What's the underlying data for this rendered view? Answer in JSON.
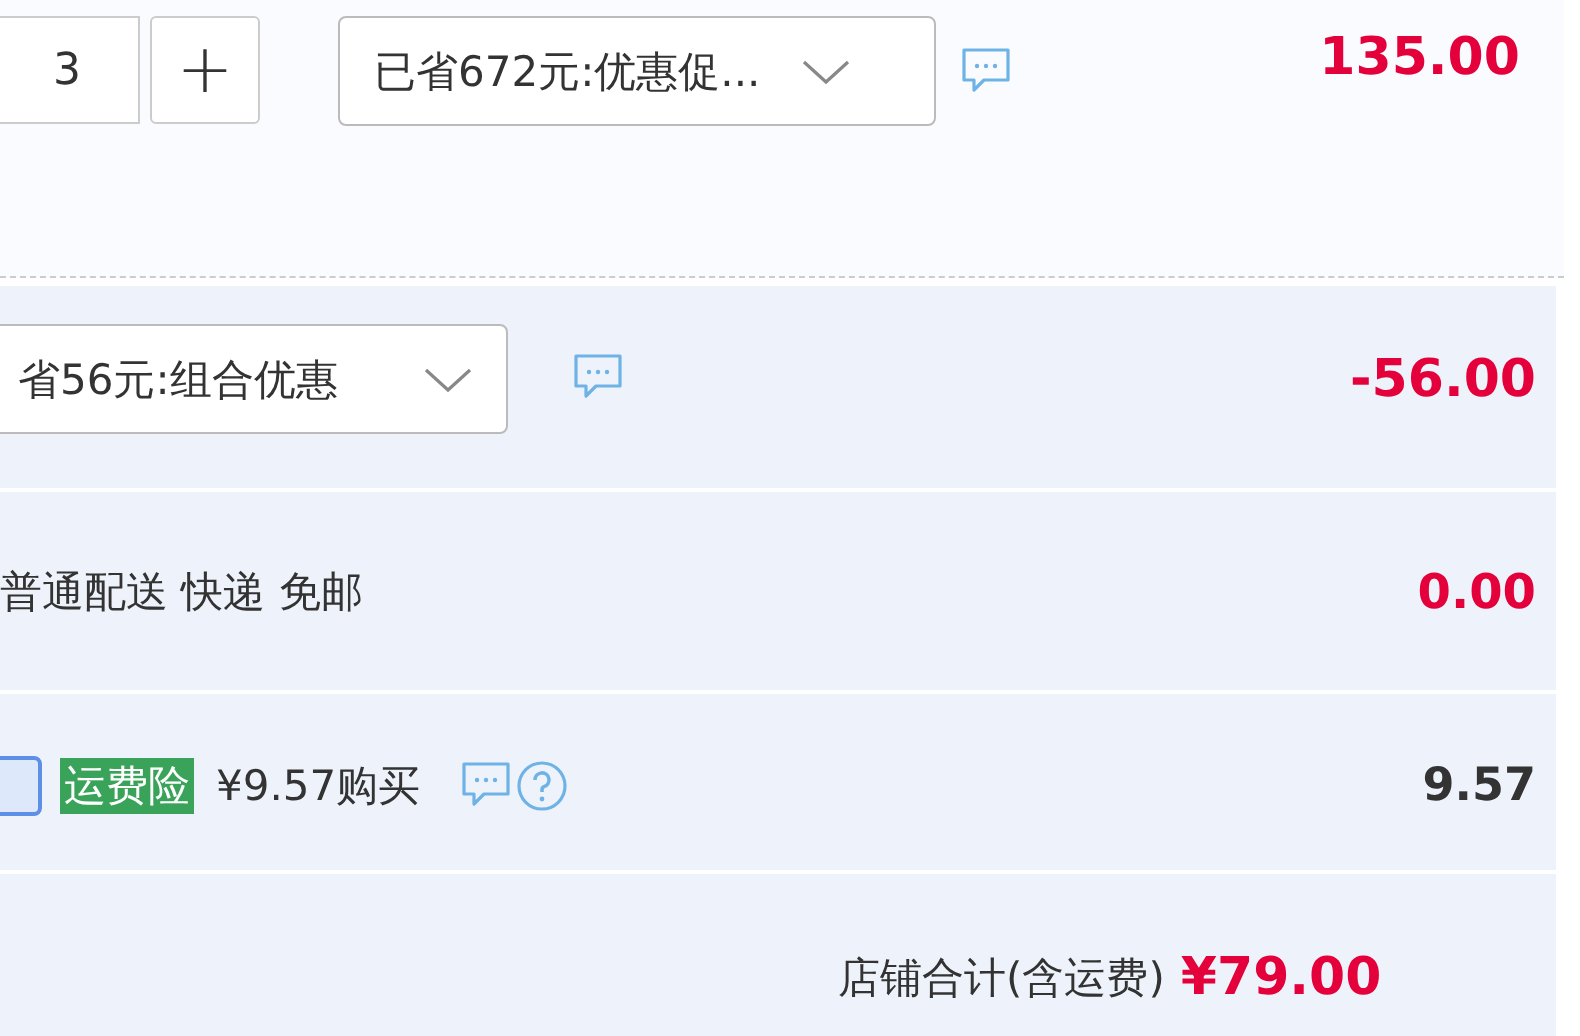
{
  "item": {
    "quantity": "3",
    "plus": "+",
    "promotion": "已省672元:优惠促...",
    "price": "135.00"
  },
  "combo": {
    "promotion": "省56元:组合优惠",
    "amount": "-56.00"
  },
  "shipping": {
    "method": "普通配送 快递 免邮",
    "amount": "0.00"
  },
  "insurance": {
    "checked": false,
    "tag": "运费险",
    "offer": "¥9.57购买",
    "amount": "9.57"
  },
  "total": {
    "label": "店铺合计(含运费)",
    "amount": "¥79.00"
  }
}
